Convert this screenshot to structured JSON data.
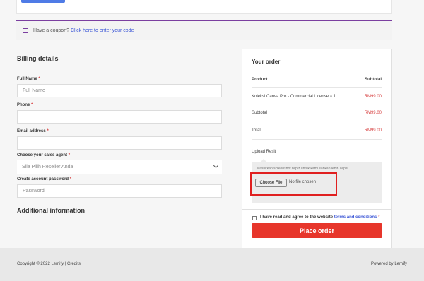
{
  "coupon": {
    "text": "Have a coupon?",
    "link": "Click here to enter your code"
  },
  "billing": {
    "title": "Billing details",
    "full_name": {
      "label": "Full Name",
      "placeholder": "Full Name"
    },
    "phone": {
      "label": "Phone",
      "value": ""
    },
    "email": {
      "label": "Email address",
      "value": ""
    },
    "sales_agent": {
      "label": "Choose your sales agent",
      "selected": "Sila Pilih Reseller Anda"
    },
    "password": {
      "label": "Create account password",
      "placeholder": "Password"
    },
    "required_mark": "*"
  },
  "additional": {
    "title": "Additional information"
  },
  "order": {
    "title": "Your order",
    "col_product": "Product",
    "col_subtotal": "Subtotal",
    "item_name": "Koleksi Canva Pro - Commercial License",
    "item_qty": "× 1",
    "item_price": "RM99.00",
    "subtotal_label": "Subtotal",
    "subtotal_value": "RM99.00",
    "total_label": "Total",
    "total_value": "RM99.00",
    "upload_label": "Upload Resit",
    "upload_hint": "Masukkan screenshot bilplz untuk kami sahkan lebih cepat",
    "choose_file": "Choose File",
    "no_file": "No file chosen",
    "terms_text": "I have read and agree to the website",
    "terms_link": "terms and conditions",
    "place_order": "Place order"
  },
  "footer": {
    "copyright": "Copyright © 2022 Lemify | Credits",
    "powered": "Powered by Lemify"
  },
  "colors": {
    "accent_purple": "#7b3fa0",
    "price_red": "#d63b3b",
    "button_red": "#e7362b",
    "link_blue": "#3a55d6"
  }
}
